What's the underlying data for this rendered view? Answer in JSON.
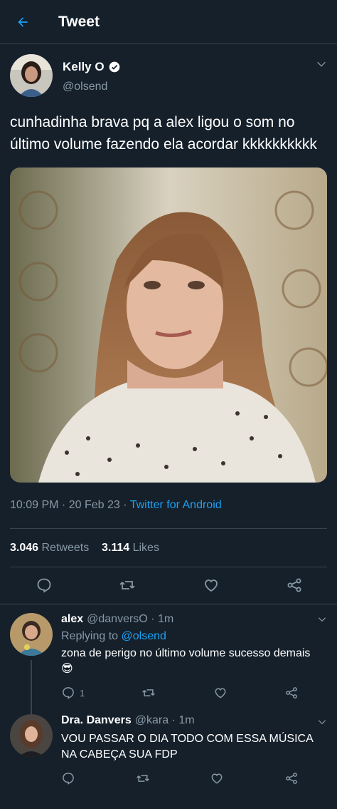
{
  "header": {
    "title": "Tweet"
  },
  "tweet": {
    "author_name": "Kelly O",
    "author_handle": "@olsend",
    "text": "cunhadinha brava pq a alex ligou o som no último volume fazendo ela acordar kkkkkkkkkk",
    "time": "10:09 PM",
    "date": "20 Feb 23",
    "source": "Twitter for Android",
    "retweets_count": "3.046",
    "retweets_label": "Retweets",
    "likes_count": "3.114",
    "likes_label": "Likes"
  },
  "replies": [
    {
      "name": "alex",
      "handle": "@danversO",
      "time": "1m",
      "replying_label": "Replying to",
      "replying_to": "@olsend",
      "text": "zona de perigo no último volume sucesso demais",
      "emoji": "😎",
      "reply_count": "1"
    },
    {
      "name": "Dra. Danvers",
      "handle": "@kara",
      "time": "1m",
      "text": "VOU PASSAR O DIA TODO COM ESSA MÚSICA NA CABEÇA SUA FDP"
    }
  ],
  "colors": {
    "background": "#15202b",
    "accent": "#1da1f2",
    "secondary_text": "#8899a6",
    "divider": "#38444d"
  }
}
